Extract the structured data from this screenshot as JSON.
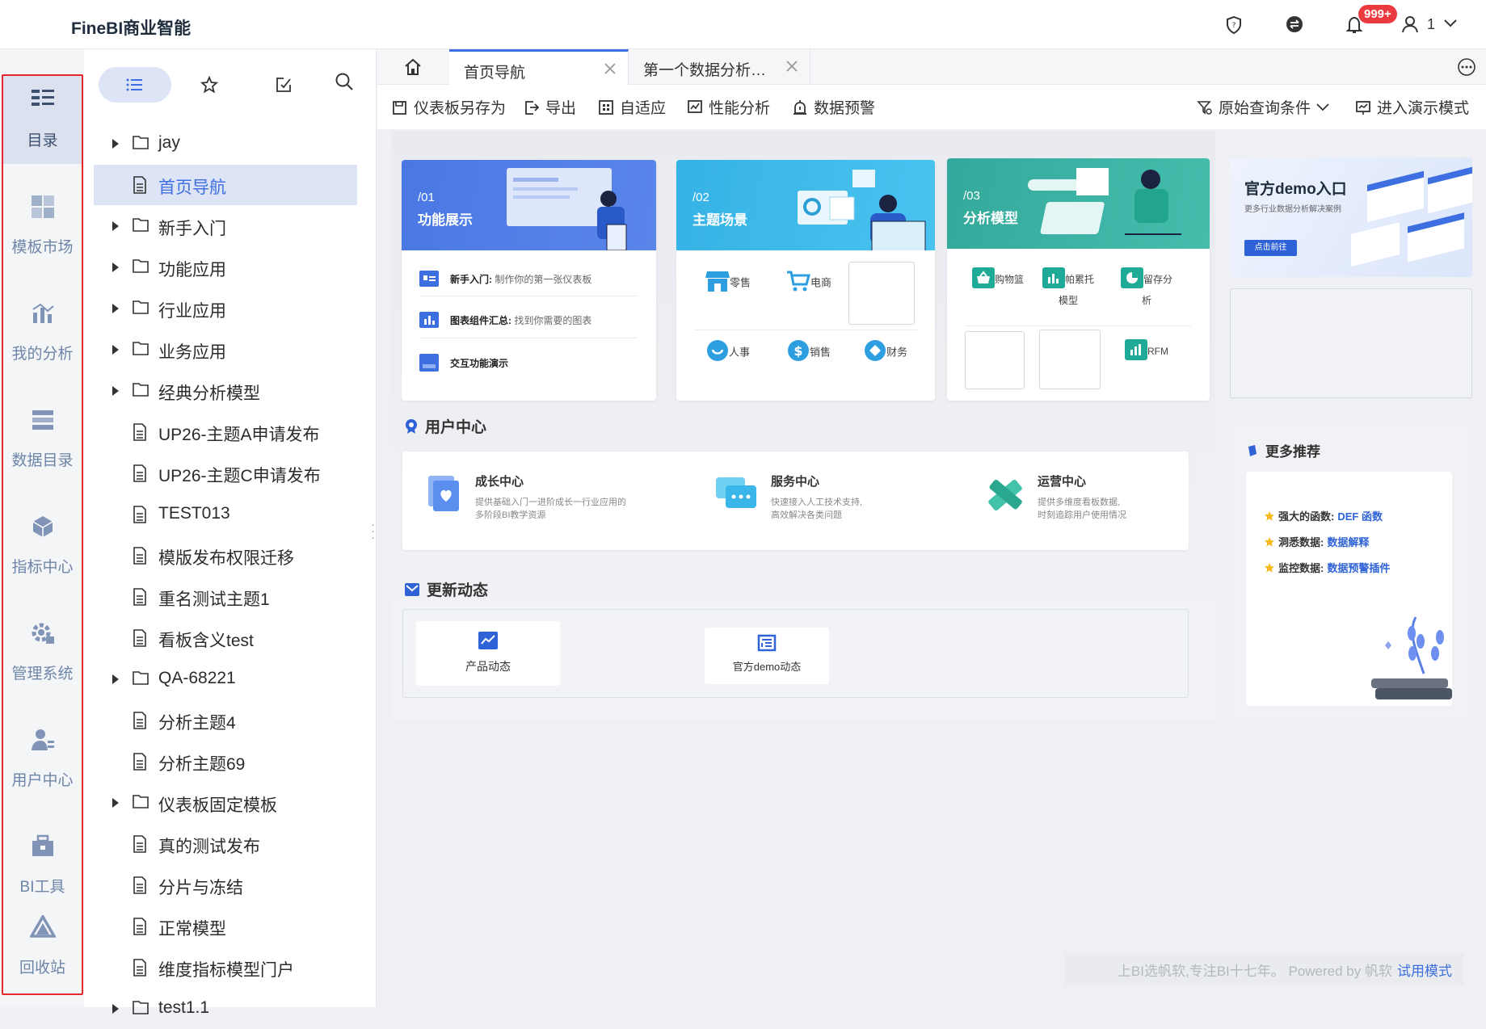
{
  "app": {
    "title": "FineBI商业智能",
    "badge": "999+",
    "user": "1"
  },
  "rail": [
    {
      "label": "目录",
      "icon": "catalog-icon",
      "active": true
    },
    {
      "label": "模板市场",
      "icon": "template-market-icon"
    },
    {
      "label": "我的分析",
      "icon": "my-analysis-icon"
    },
    {
      "label": "数据目录",
      "icon": "data-catalog-icon"
    },
    {
      "label": "指标中心",
      "icon": "metric-center-icon"
    },
    {
      "label": "管理系统",
      "icon": "admin-system-icon"
    },
    {
      "label": "用户中心",
      "icon": "user-center-icon"
    },
    {
      "label": "BI工具",
      "icon": "bi-tools-icon"
    },
    {
      "label": "回收站",
      "icon": "recycle-bin-icon"
    }
  ],
  "tree": {
    "items": [
      {
        "label": "jay",
        "type": "folder"
      },
      {
        "label": "首页导航",
        "type": "doc",
        "active": true
      },
      {
        "label": "新手入门",
        "type": "folder"
      },
      {
        "label": "功能应用",
        "type": "folder"
      },
      {
        "label": "行业应用",
        "type": "folder"
      },
      {
        "label": "业务应用",
        "type": "folder"
      },
      {
        "label": "经典分析模型",
        "type": "folder"
      },
      {
        "label": "UP26-主题A申请发布",
        "type": "doc"
      },
      {
        "label": "UP26-主题C申请发布",
        "type": "doc"
      },
      {
        "label": "TEST013",
        "type": "doc"
      },
      {
        "label": "模版发布权限迁移",
        "type": "doc"
      },
      {
        "label": "重名测试主题1",
        "type": "doc"
      },
      {
        "label": "看板含义test",
        "type": "doc"
      },
      {
        "label": "QA-68221",
        "type": "folder"
      },
      {
        "label": "分析主题4",
        "type": "doc"
      },
      {
        "label": "分析主题69",
        "type": "doc"
      },
      {
        "label": "仪表板固定模板",
        "type": "folder"
      },
      {
        "label": "真的测试发布",
        "type": "doc"
      },
      {
        "label": "分片与冻结",
        "type": "doc"
      },
      {
        "label": "正常模型",
        "type": "doc"
      },
      {
        "label": "维度指标模型门户",
        "type": "doc"
      },
      {
        "label": "test1.1",
        "type": "folder"
      }
    ]
  },
  "tabs": [
    {
      "label": "首页导航",
      "active": true
    },
    {
      "label": "第一个数据分析…"
    }
  ],
  "toolbar": {
    "save_as": "仪表板另存为",
    "export": "导出",
    "adaptive": "自适应",
    "perf": "性能分析",
    "alert": "数据预警",
    "filter": "原始查询条件",
    "present": "进入演示模式"
  },
  "cards": {
    "c1": {
      "num": "/01",
      "title": "功能展示",
      "rows": [
        {
          "b": "新手入门:",
          "t": "制作你的第一张仪表板"
        },
        {
          "b": "图表组件汇总:",
          "t": "找到你需要的图表"
        },
        {
          "b": "交互功能演示",
          "t": ""
        }
      ]
    },
    "c2": {
      "num": "/02",
      "title": "主题场景",
      "cells": [
        "零售",
        "电商",
        "人事",
        "销售",
        "财务"
      ]
    },
    "c3": {
      "num": "/03",
      "title": "分析模型",
      "cells": [
        "购物篮",
        "帕累托模型",
        "留存分析",
        "RFM"
      ]
    }
  },
  "user_center": {
    "title": "用户中心",
    "items": [
      {
        "t": "成长中心",
        "d1": "提供基础入门一进阶成长一行业应用的",
        "d2": "多阶段BI教学资源"
      },
      {
        "t": "服务中心",
        "d1": "快速接入人工技术支持,",
        "d2": "高效解决各类问题"
      },
      {
        "t": "运营中心",
        "d1": "提供多维度看板数据,",
        "d2": "时刻追踪用户使用情况"
      }
    ]
  },
  "updates": {
    "title": "更新动态",
    "items": [
      "产品动态",
      "官方demo动态"
    ]
  },
  "demo": {
    "title": "官方demo入口",
    "sub": "更多行业数据分析解决案例",
    "btn": "点击前往"
  },
  "more": {
    "title": "更多推荐",
    "items": [
      {
        "k": "强大的函数:",
        "v": "DEF 函数"
      },
      {
        "k": "洞悉数据:",
        "v": "数据解释"
      },
      {
        "k": "监控数据:",
        "v": "数据预警插件"
      }
    ]
  },
  "footer": {
    "text": "上BI选帆软,专注BI十七年。 Powered by 帆软",
    "link": "试用模式"
  },
  "colors": {
    "accent": "#3d6fe0",
    "c1": "#4a78e3",
    "c2": "#3bb3e8",
    "c3": "#3cb4a5",
    "highlight": "#e6282c"
  }
}
